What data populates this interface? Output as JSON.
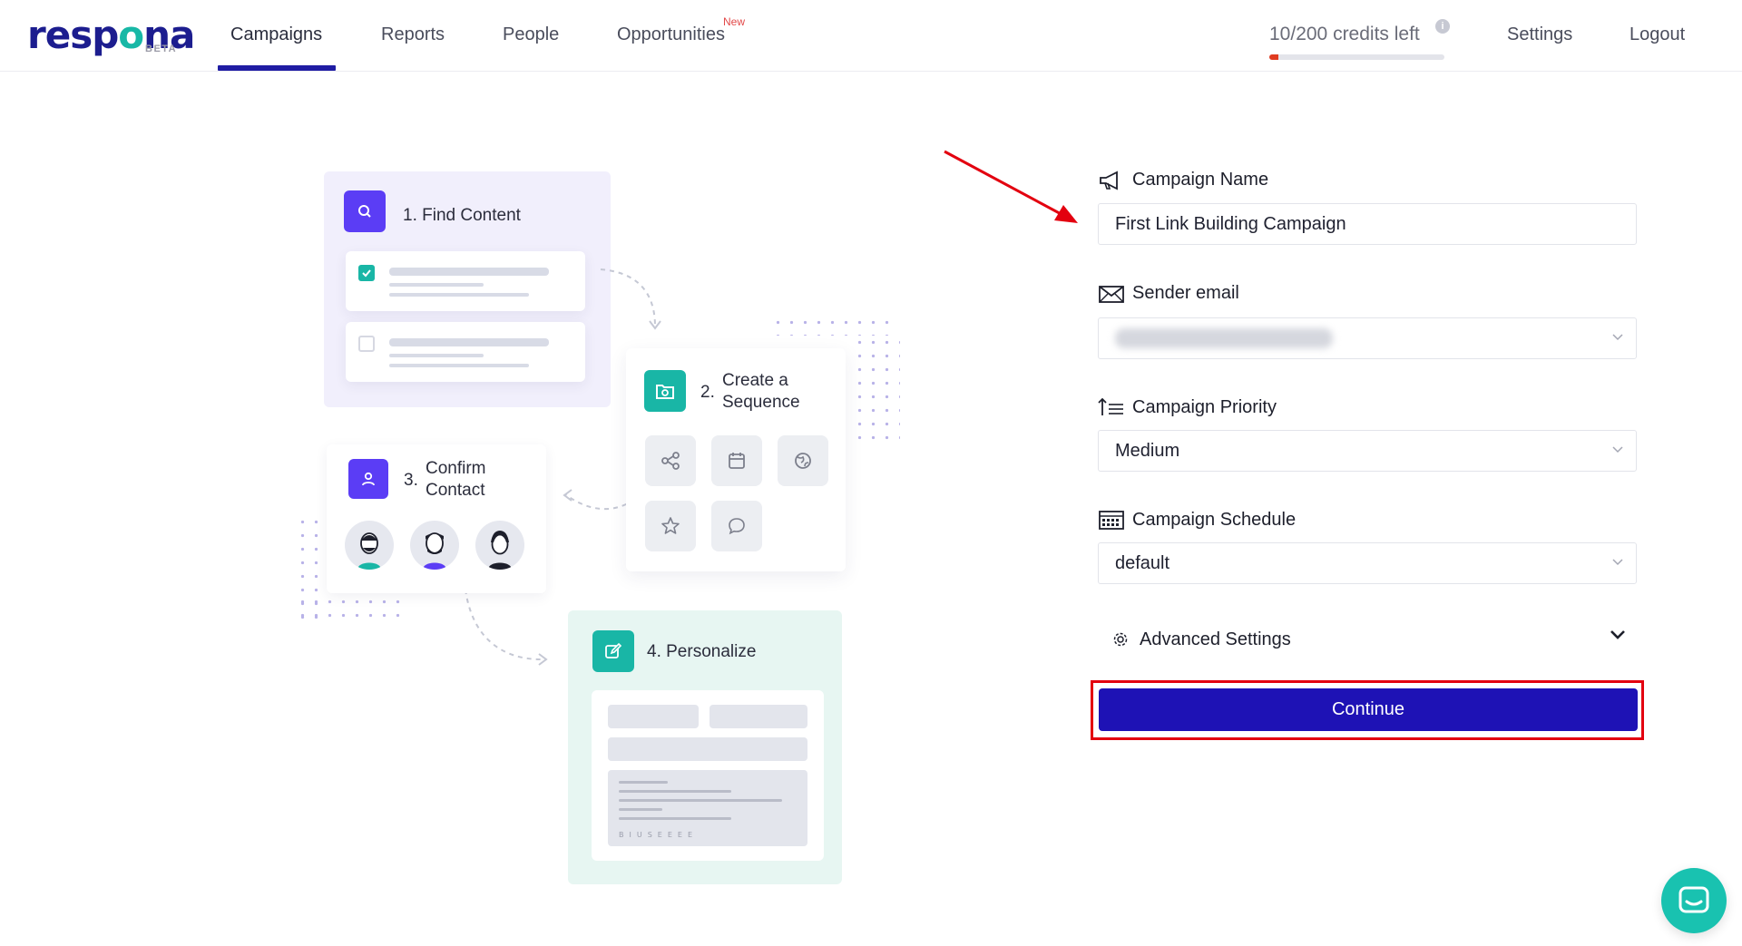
{
  "app": {
    "logo_text": "respona",
    "logo_badge": "BETA"
  },
  "nav": {
    "items": [
      {
        "label": "Campaigns",
        "active": true
      },
      {
        "label": "Reports"
      },
      {
        "label": "People"
      },
      {
        "label": "Opportunities",
        "badge": "New"
      }
    ],
    "credits_text": "10/200 credits left",
    "credits_used_fraction": 0.05,
    "settings_label": "Settings",
    "logout_label": "Logout"
  },
  "illustration": {
    "step1": "1. Find Content",
    "step2_num": "2.",
    "step2_line1": "Create a",
    "step2_line2": "Sequence",
    "step3_num": "3.",
    "step3_line1": "Confirm",
    "step3_line2": "Contact",
    "step4": "4. Personalize"
  },
  "form": {
    "campaign_name_label": "Campaign Name",
    "campaign_name_value": "First Link Building Campaign",
    "sender_email_label": "Sender email",
    "sender_email_value": "",
    "priority_label": "Campaign Priority",
    "priority_value": "Medium",
    "schedule_label": "Campaign Schedule",
    "schedule_value": "default",
    "advanced_label": "Advanced Settings",
    "continue_label": "Continue"
  },
  "colors": {
    "brand_navy": "#1c1d8f",
    "primary_button": "#1e12b5",
    "accent_teal": "#19c2b0",
    "accent_purple": "#5b3df5",
    "annotation_red": "#e3000f"
  }
}
